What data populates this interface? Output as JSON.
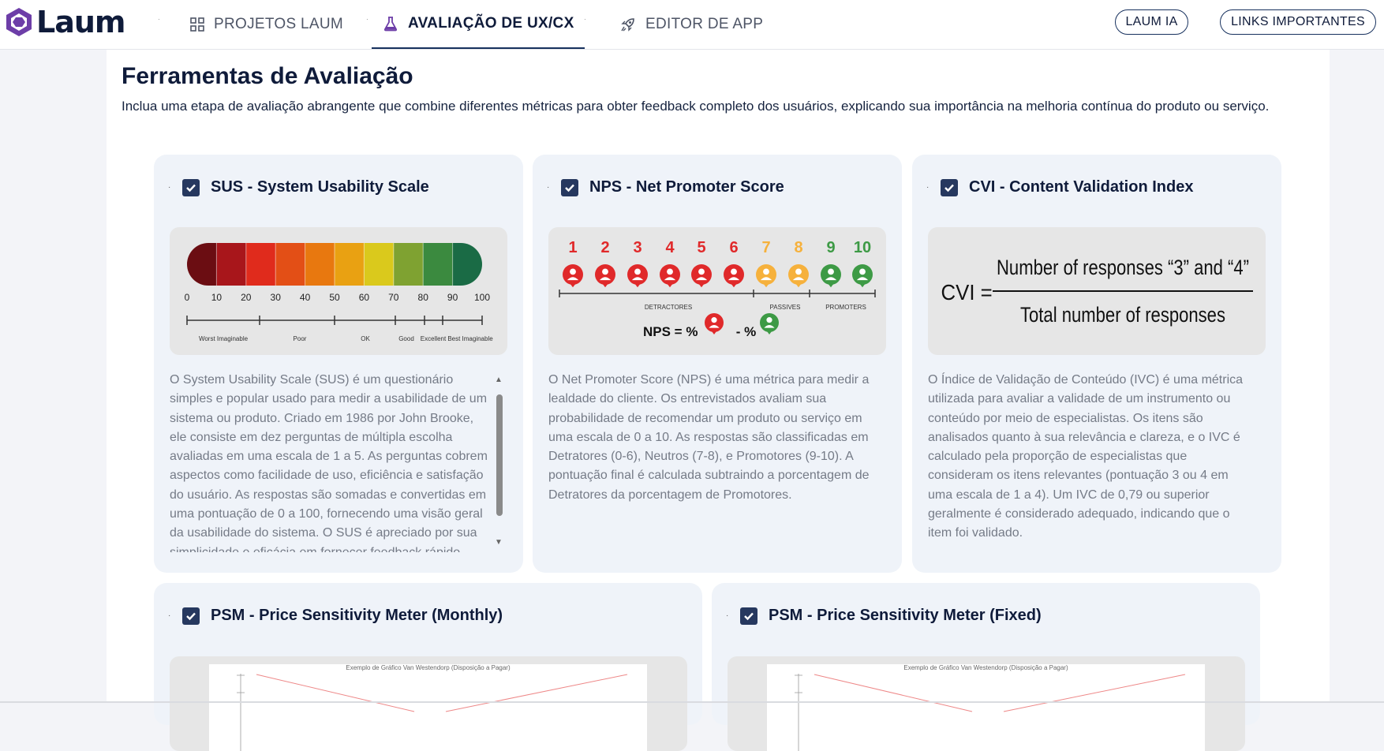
{
  "brand": {
    "name": "Laum"
  },
  "nav": {
    "tabs": [
      {
        "label": "PROJETOS LAUM",
        "icon": "grid-icon"
      },
      {
        "label": "AVALIAÇÃO DE UX/CX",
        "icon": "flask-icon"
      },
      {
        "label": "EDITOR DE APP",
        "icon": "rocket-icon"
      }
    ],
    "buttons": [
      {
        "label": "LAUM IA"
      },
      {
        "label": "LINKS IMPORTANTES"
      }
    ]
  },
  "page": {
    "title": "Ferramentas de Avaliação",
    "description": "Inclua uma etapa de avaliação abrangente que combine diferentes métricas para obter feedback completo dos usuários, explicando sua importância na melhoria contínua do produto ou serviço."
  },
  "cards": [
    {
      "title": "SUS - System Usability Scale",
      "checked": true,
      "text": "O System Usability Scale (SUS) é um questionário simples e popular usado para medir a usabilidade de um sistema ou produto. Criado em 1986 por John Brooke, ele consiste em dez perguntas de múltipla escolha avaliadas em uma escala de 1 a 5. As perguntas cobrem aspectos como facilidade de uso, eficiência e satisfação do usuário. As respostas são somadas e convertidas em uma pontuação de 0 a 100, fornecendo uma visão geral da usabilidade do sistema. O SUS é apreciado por sua simplicidade e eficácia em fornecer feedback rápido.",
      "scale": {
        "ticks": [
          "0",
          "10",
          "20",
          "30",
          "40",
          "50",
          "60",
          "70",
          "80",
          "90",
          "100"
        ],
        "labels": [
          "Worst Imaginable",
          "Poor",
          "OK",
          "Good",
          "Excellent",
          "Best Imaginable"
        ],
        "colors": [
          "#6b0d12",
          "#a8161b",
          "#e02b1c",
          "#e34f16",
          "#e8780f",
          "#e9a112",
          "#dac91c",
          "#7fa231",
          "#3b8a3f",
          "#1a6b45"
        ]
      }
    },
    {
      "title": "NPS - Net Promoter Score",
      "checked": true,
      "text": "O Net Promoter Score (NPS) é uma métrica para medir a lealdade do cliente. Os entrevistados avaliam sua probabilidade de recomendar um produto ou serviço em uma escala de 0 a 10. As respostas são classificadas em Detratores (0-6), Neutros (7-8), e Promotores (9-10). A pontuação final é calculada subtraindo a porcentagem de Detratores da porcentagem de Promotores.",
      "scale": {
        "numbers": [
          "1",
          "2",
          "3",
          "4",
          "5",
          "6",
          "7",
          "8",
          "9",
          "10"
        ],
        "groups": [
          "DETRACTORES",
          "PASSIVES",
          "PROMOTERS"
        ],
        "formula": {
          "lhs": "NPS = %",
          "mid": " - %"
        },
        "colors": {
          "detractor": "#e0292a",
          "passive": "#f6b13c",
          "promoter": "#3d9a45"
        }
      }
    },
    {
      "title": "CVI - Content Validation Index",
      "checked": true,
      "text": "O Índice de Validação de Conteúdo (IVC) é uma métrica utilizada para avaliar a validade de um instrumento ou conteúdo por meio de especialistas. Os itens são analisados quanto à sua relevância e clareza, e o IVC é calculado pela proporção de especialistas que consideram os itens relevantes (pontuação 3 ou 4 em uma escala de 1 a 4). Um IVC de 0,79 ou superior geralmente é considerado adequado, indicando que o item foi validado.",
      "formula": {
        "lhs": "CVI =",
        "numerator": "Number of responses “3” and “4”",
        "denominator": "Total number of responses"
      }
    },
    {
      "title": "PSM - Price Sensitivity Meter (Monthly)",
      "checked": true,
      "chart_caption": "Exemplo de Gráfico Van Westendorp (Disposição a Pagar)"
    },
    {
      "title": "PSM - Price Sensitivity Meter (Fixed)",
      "checked": true,
      "chart_caption": "Exemplo de Gráfico Van Westendorp (Disposição a Pagar)"
    }
  ]
}
